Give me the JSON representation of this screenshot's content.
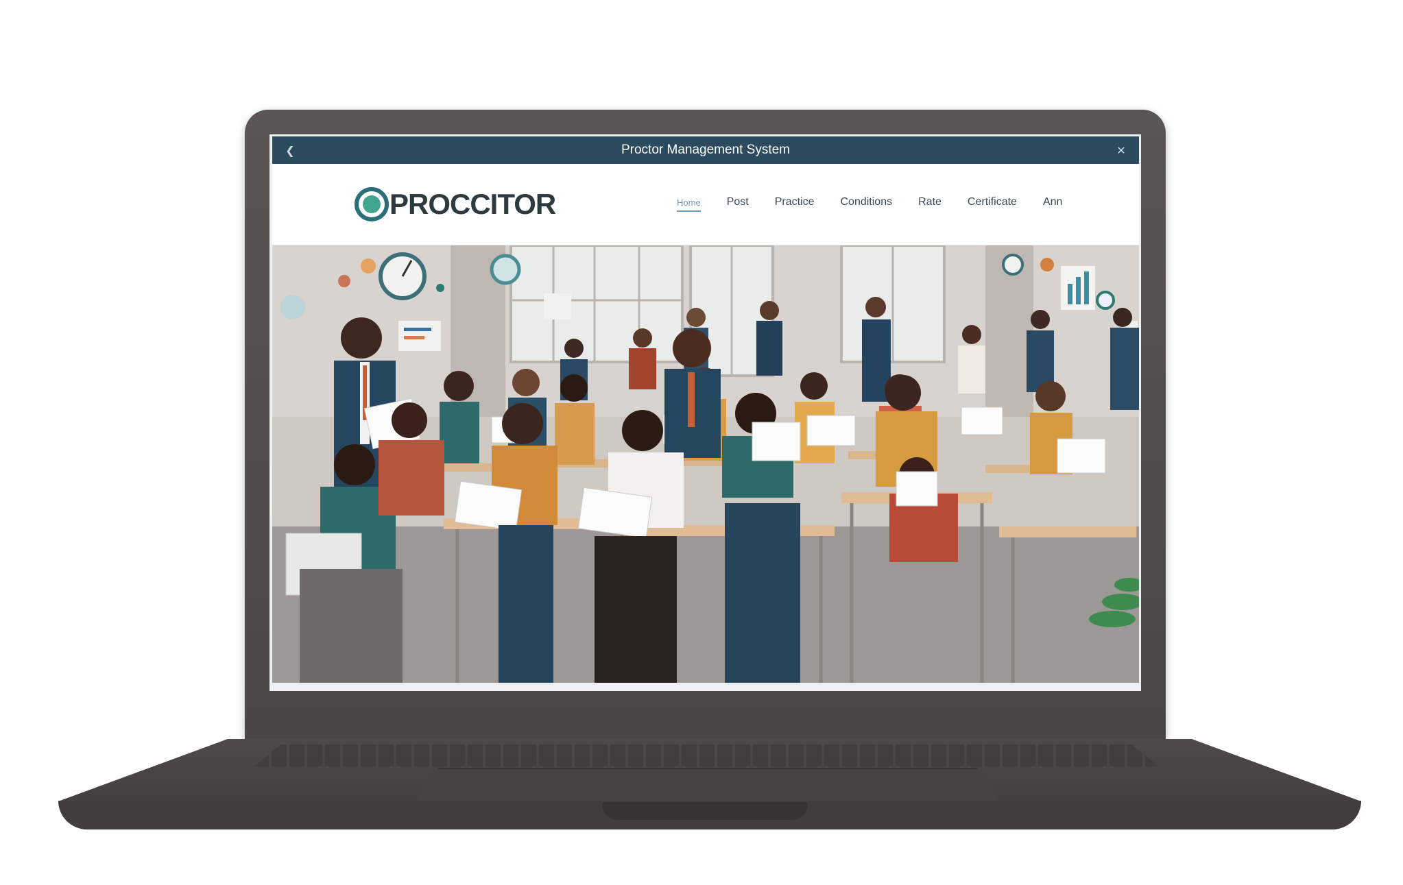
{
  "window": {
    "title": "Proctor Management System",
    "back_icon": "chevron-left-icon",
    "close_icon": "close-icon"
  },
  "header": {
    "logo_text": "PROCCITOR",
    "logo_icon": "circle-logo-icon",
    "nav": [
      {
        "label": "Home",
        "active": true
      },
      {
        "label": "Post",
        "active": false
      },
      {
        "label": "Practice",
        "active": false
      },
      {
        "label": "Conditions",
        "active": false
      },
      {
        "label": "Rate",
        "active": false
      },
      {
        "label": "Certificate",
        "active": false
      },
      {
        "label": "Ann",
        "active": false
      }
    ]
  },
  "hero": {
    "description_icon": "classroom-exam-illustration"
  },
  "colors": {
    "titlebar": "#2b4a5e",
    "accent": "#2a6f78",
    "brand_green": "#3fa58f",
    "nav_active": "#6c9fb5"
  }
}
